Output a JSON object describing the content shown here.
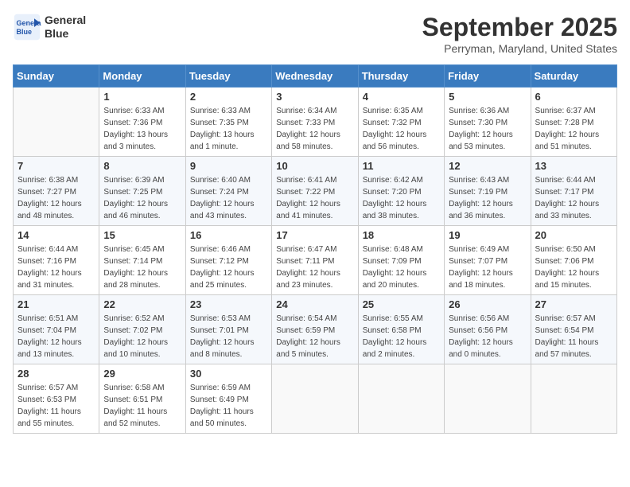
{
  "header": {
    "logo_line1": "General",
    "logo_line2": "Blue",
    "month": "September 2025",
    "location": "Perryman, Maryland, United States"
  },
  "days_of_week": [
    "Sunday",
    "Monday",
    "Tuesday",
    "Wednesday",
    "Thursday",
    "Friday",
    "Saturday"
  ],
  "weeks": [
    [
      {
        "num": "",
        "sunrise": "",
        "sunset": "",
        "daylight": ""
      },
      {
        "num": "1",
        "sunrise": "Sunrise: 6:33 AM",
        "sunset": "Sunset: 7:36 PM",
        "daylight": "Daylight: 13 hours and 3 minutes."
      },
      {
        "num": "2",
        "sunrise": "Sunrise: 6:33 AM",
        "sunset": "Sunset: 7:35 PM",
        "daylight": "Daylight: 13 hours and 1 minute."
      },
      {
        "num": "3",
        "sunrise": "Sunrise: 6:34 AM",
        "sunset": "Sunset: 7:33 PM",
        "daylight": "Daylight: 12 hours and 58 minutes."
      },
      {
        "num": "4",
        "sunrise": "Sunrise: 6:35 AM",
        "sunset": "Sunset: 7:32 PM",
        "daylight": "Daylight: 12 hours and 56 minutes."
      },
      {
        "num": "5",
        "sunrise": "Sunrise: 6:36 AM",
        "sunset": "Sunset: 7:30 PM",
        "daylight": "Daylight: 12 hours and 53 minutes."
      },
      {
        "num": "6",
        "sunrise": "Sunrise: 6:37 AM",
        "sunset": "Sunset: 7:28 PM",
        "daylight": "Daylight: 12 hours and 51 minutes."
      }
    ],
    [
      {
        "num": "7",
        "sunrise": "Sunrise: 6:38 AM",
        "sunset": "Sunset: 7:27 PM",
        "daylight": "Daylight: 12 hours and 48 minutes."
      },
      {
        "num": "8",
        "sunrise": "Sunrise: 6:39 AM",
        "sunset": "Sunset: 7:25 PM",
        "daylight": "Daylight: 12 hours and 46 minutes."
      },
      {
        "num": "9",
        "sunrise": "Sunrise: 6:40 AM",
        "sunset": "Sunset: 7:24 PM",
        "daylight": "Daylight: 12 hours and 43 minutes."
      },
      {
        "num": "10",
        "sunrise": "Sunrise: 6:41 AM",
        "sunset": "Sunset: 7:22 PM",
        "daylight": "Daylight: 12 hours and 41 minutes."
      },
      {
        "num": "11",
        "sunrise": "Sunrise: 6:42 AM",
        "sunset": "Sunset: 7:20 PM",
        "daylight": "Daylight: 12 hours and 38 minutes."
      },
      {
        "num": "12",
        "sunrise": "Sunrise: 6:43 AM",
        "sunset": "Sunset: 7:19 PM",
        "daylight": "Daylight: 12 hours and 36 minutes."
      },
      {
        "num": "13",
        "sunrise": "Sunrise: 6:44 AM",
        "sunset": "Sunset: 7:17 PM",
        "daylight": "Daylight: 12 hours and 33 minutes."
      }
    ],
    [
      {
        "num": "14",
        "sunrise": "Sunrise: 6:44 AM",
        "sunset": "Sunset: 7:16 PM",
        "daylight": "Daylight: 12 hours and 31 minutes."
      },
      {
        "num": "15",
        "sunrise": "Sunrise: 6:45 AM",
        "sunset": "Sunset: 7:14 PM",
        "daylight": "Daylight: 12 hours and 28 minutes."
      },
      {
        "num": "16",
        "sunrise": "Sunrise: 6:46 AM",
        "sunset": "Sunset: 7:12 PM",
        "daylight": "Daylight: 12 hours and 25 minutes."
      },
      {
        "num": "17",
        "sunrise": "Sunrise: 6:47 AM",
        "sunset": "Sunset: 7:11 PM",
        "daylight": "Daylight: 12 hours and 23 minutes."
      },
      {
        "num": "18",
        "sunrise": "Sunrise: 6:48 AM",
        "sunset": "Sunset: 7:09 PM",
        "daylight": "Daylight: 12 hours and 20 minutes."
      },
      {
        "num": "19",
        "sunrise": "Sunrise: 6:49 AM",
        "sunset": "Sunset: 7:07 PM",
        "daylight": "Daylight: 12 hours and 18 minutes."
      },
      {
        "num": "20",
        "sunrise": "Sunrise: 6:50 AM",
        "sunset": "Sunset: 7:06 PM",
        "daylight": "Daylight: 12 hours and 15 minutes."
      }
    ],
    [
      {
        "num": "21",
        "sunrise": "Sunrise: 6:51 AM",
        "sunset": "Sunset: 7:04 PM",
        "daylight": "Daylight: 12 hours and 13 minutes."
      },
      {
        "num": "22",
        "sunrise": "Sunrise: 6:52 AM",
        "sunset": "Sunset: 7:02 PM",
        "daylight": "Daylight: 12 hours and 10 minutes."
      },
      {
        "num": "23",
        "sunrise": "Sunrise: 6:53 AM",
        "sunset": "Sunset: 7:01 PM",
        "daylight": "Daylight: 12 hours and 8 minutes."
      },
      {
        "num": "24",
        "sunrise": "Sunrise: 6:54 AM",
        "sunset": "Sunset: 6:59 PM",
        "daylight": "Daylight: 12 hours and 5 minutes."
      },
      {
        "num": "25",
        "sunrise": "Sunrise: 6:55 AM",
        "sunset": "Sunset: 6:58 PM",
        "daylight": "Daylight: 12 hours and 2 minutes."
      },
      {
        "num": "26",
        "sunrise": "Sunrise: 6:56 AM",
        "sunset": "Sunset: 6:56 PM",
        "daylight": "Daylight: 12 hours and 0 minutes."
      },
      {
        "num": "27",
        "sunrise": "Sunrise: 6:57 AM",
        "sunset": "Sunset: 6:54 PM",
        "daylight": "Daylight: 11 hours and 57 minutes."
      }
    ],
    [
      {
        "num": "28",
        "sunrise": "Sunrise: 6:57 AM",
        "sunset": "Sunset: 6:53 PM",
        "daylight": "Daylight: 11 hours and 55 minutes."
      },
      {
        "num": "29",
        "sunrise": "Sunrise: 6:58 AM",
        "sunset": "Sunset: 6:51 PM",
        "daylight": "Daylight: 11 hours and 52 minutes."
      },
      {
        "num": "30",
        "sunrise": "Sunrise: 6:59 AM",
        "sunset": "Sunset: 6:49 PM",
        "daylight": "Daylight: 11 hours and 50 minutes."
      },
      {
        "num": "",
        "sunrise": "",
        "sunset": "",
        "daylight": ""
      },
      {
        "num": "",
        "sunrise": "",
        "sunset": "",
        "daylight": ""
      },
      {
        "num": "",
        "sunrise": "",
        "sunset": "",
        "daylight": ""
      },
      {
        "num": "",
        "sunrise": "",
        "sunset": "",
        "daylight": ""
      }
    ]
  ]
}
